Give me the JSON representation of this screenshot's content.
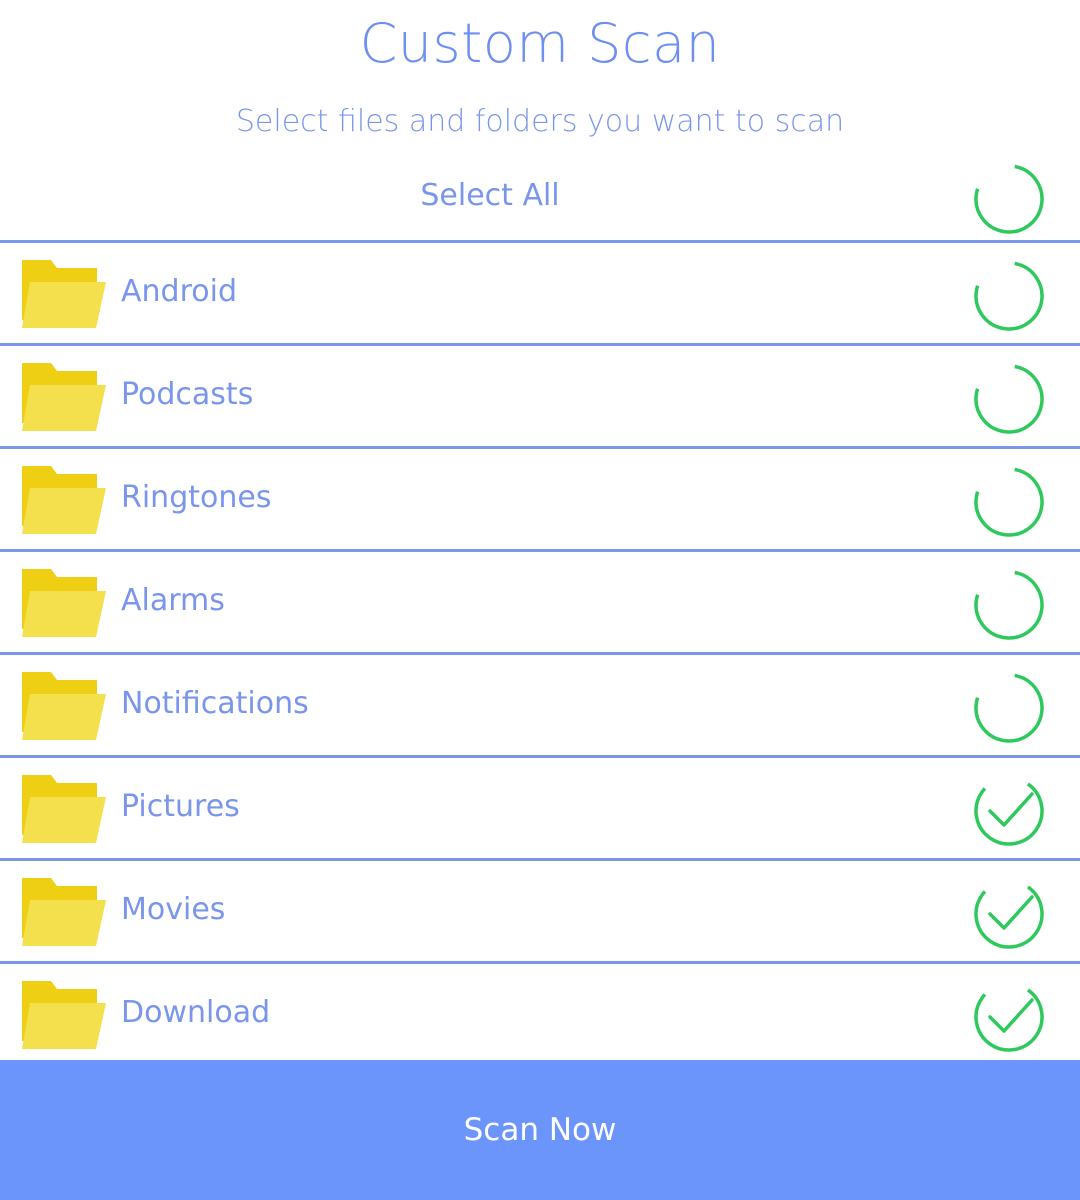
{
  "header": {
    "title": "Custom Scan",
    "subtitle": "Select files and folders you want to scan"
  },
  "select_all": {
    "label": "Select All",
    "status_icon": "loading-ring-icon"
  },
  "folders": [
    {
      "label": "Android",
      "status_icon": "loading-ring-icon",
      "selected": false
    },
    {
      "label": "Podcasts",
      "status_icon": "loading-ring-icon",
      "selected": false
    },
    {
      "label": "Ringtones",
      "status_icon": "loading-ring-icon",
      "selected": false
    },
    {
      "label": "Alarms",
      "status_icon": "loading-ring-icon",
      "selected": false
    },
    {
      "label": "Notifications",
      "status_icon": "loading-ring-icon",
      "selected": false
    },
    {
      "label": "Pictures",
      "status_icon": "check-circle-icon",
      "selected": true
    },
    {
      "label": "Movies",
      "status_icon": "check-circle-icon",
      "selected": true
    },
    {
      "label": "Download",
      "status_icon": "check-circle-icon",
      "selected": true
    }
  ],
  "footer": {
    "scan_label": "Scan Now"
  },
  "colors": {
    "accent_blue": "#6b95fb",
    "text_blue": "#7a96ec",
    "status_green": "#2ec95c",
    "folder_yellow": "#f2d21b"
  }
}
